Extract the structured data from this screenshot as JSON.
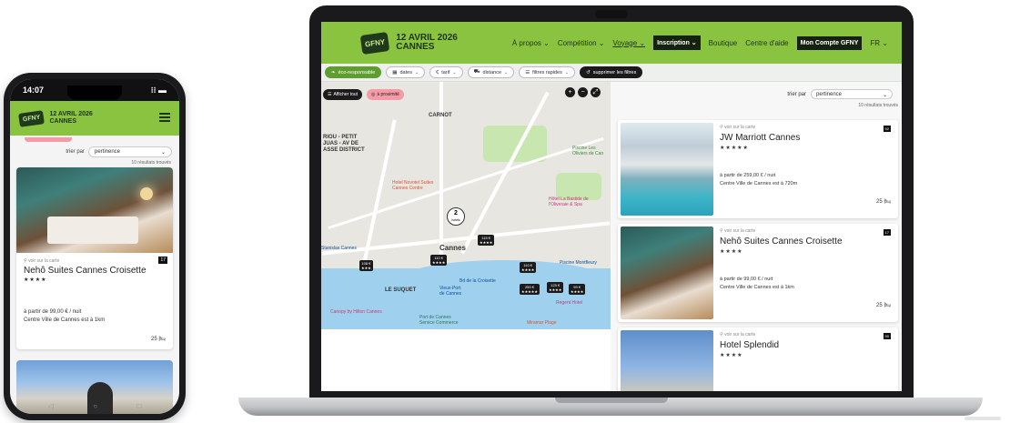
{
  "event": {
    "date": "12 AVRIL 2026",
    "city": "CANNES",
    "logo_text": "GFNY"
  },
  "phone": {
    "time": "14:07",
    "status_icons": "⁝⁝ ▬",
    "sort_label": "trier par",
    "sort_value": "pertinence",
    "results_count": "10 résultats trouvés",
    "card": {
      "location_link": "voir sur la carte",
      "score": "17",
      "name": "Nehô Suites Cannes Croisette",
      "stars": "★★★★",
      "price": "à partir de  99,00 € / nuit",
      "distance": "Centre Ville de Cannes est à 1km",
      "rooms": "25"
    }
  },
  "laptop": {
    "nav": {
      "items": [
        "À propos ⌄",
        "Compétition ⌄",
        "Voyage ⌄"
      ],
      "register": "Inscription ⌄",
      "shop": "Boutique",
      "help": "Centre d'aide",
      "account": "Mon Compte GFNY",
      "lang": "FR ⌄"
    },
    "filters": {
      "eco": "éco-responsable",
      "dates": "dates",
      "price": "tarif",
      "distance": "distance",
      "quick": "filtres rapides",
      "clear": "supprimer les filtres"
    },
    "map": {
      "show_all": "Afficher tout",
      "nearby": "à proximité",
      "zoom_in": "+",
      "zoom_out": "−",
      "expand": "⤢",
      "labels": {
        "carnot": "CARNOT",
        "riou": "RIOU - PETIT\nJUAS - AV DE\nASSE DISTRICT",
        "cannes": "Cannes",
        "suquet": "LE SUQUET",
        "novotel": "Hotel Novotel Suites\nCannes Centre",
        "olivier": "Piscine Les\nOliviers de Can",
        "bastide": "Hôtel La Bastide de\nl'Oliveraie & Spa",
        "croisette": "Bd de la Croisette",
        "vieux_port": "Vieux-Port\nde Cannes",
        "hilton": "Canopy by Hilton Cannes",
        "port_canto": "Port de Cannes\nService Commerce",
        "regent": "Regent Hotel",
        "montfleury": "Piscine Montfleury",
        "stanislas": "Stanislas Cannes",
        "miramar": "Miramar Plage"
      },
      "cluster": {
        "count": "2",
        "label": "hotels"
      },
      "pins": [
        {
          "price": "115 €",
          "stars": "★★★★"
        },
        {
          "price": "110 €",
          "stars": "★★★★"
        },
        {
          "price": "108 €",
          "stars": "★★★"
        },
        {
          "price": "110 €",
          "stars": "★★★★"
        },
        {
          "price": "259 €",
          "stars": "★★★★★"
        },
        {
          "price": "125 €",
          "stars": "★★★★"
        },
        {
          "price": "99 €",
          "stars": "★★★★"
        }
      ]
    },
    "results": {
      "sort_label": "trier par",
      "sort_value": "pertinence",
      "count": "10 résultats trouvés",
      "hotels": [
        {
          "score": "92",
          "location_link": "voir sur la carte",
          "name": "JW Marriott Cannes",
          "stars": "★★★★★",
          "price": "à partir de  259,00 € / nuit",
          "distance": "Centre Ville de Cannes est à 720m",
          "rooms": "25"
        },
        {
          "score": "17",
          "location_link": "voir sur la carte",
          "name": "Nehô Suites Cannes Croisette",
          "stars": "★★★★",
          "price": "à partir de  99,00 € / nuit",
          "distance": "Centre Ville de Cannes est à 1km",
          "rooms": "25"
        },
        {
          "score": "90",
          "location_link": "voir sur la carte",
          "name": "Hotel Splendid",
          "stars": "★★★★"
        }
      ]
    }
  }
}
